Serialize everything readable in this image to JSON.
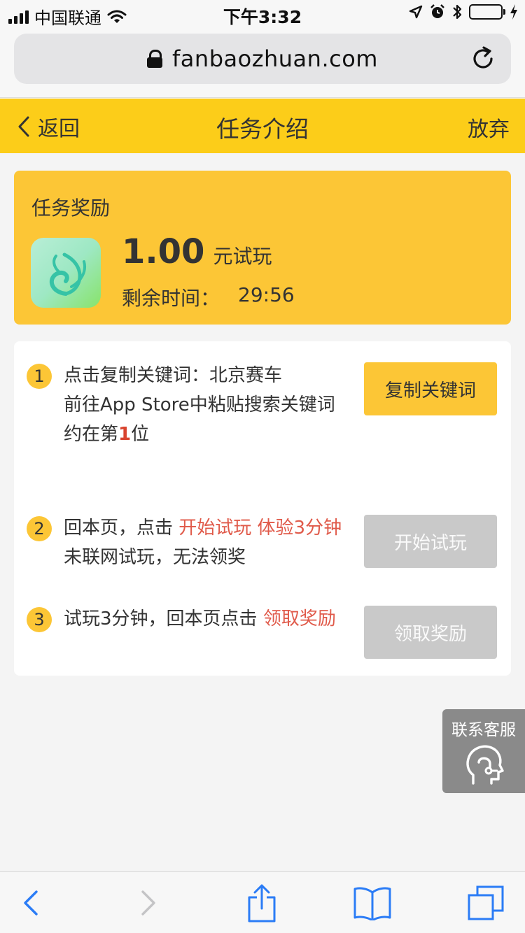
{
  "status_bar": {
    "carrier": "中国联通",
    "time": "下午3:32"
  },
  "browser": {
    "url": "fanbaozhuan.com"
  },
  "nav": {
    "back_label": "返回",
    "title": "任务介绍",
    "abandon_label": "放弃"
  },
  "reward": {
    "title": "任务奖励",
    "amount": "1.00",
    "amount_unit": "元试玩",
    "time_label": "剩余时间：",
    "time_value": "29:56"
  },
  "steps": [
    {
      "number": "1",
      "line1": "点击复制关键词：北京赛车",
      "line2": "前往App Store中粘贴搜索关键词",
      "line3_prefix": "约在第",
      "line3_rank": "1",
      "line3_suffix": "位",
      "button": "复制关键词"
    },
    {
      "number": "2",
      "line1_prefix": "回本页，点击 ",
      "line1_highlight": "开始试玩 体验3分钟",
      "line2": "未联网试玩，无法领奖",
      "button": "开始试玩"
    },
    {
      "number": "3",
      "line1_prefix": "试玩3分钟，回本页点击 ",
      "line1_highlight": "领取奖励",
      "button": "领取奖励"
    }
  ],
  "customer_service": {
    "label": "联系客服"
  },
  "colors": {
    "brand_yellow": "#fccd19",
    "card_yellow": "#fcc636",
    "highlight_red": "#e05a4a",
    "disabled_grey": "#c9c9c9",
    "ios_blue": "#2b7cf6"
  },
  "icons": {
    "status": [
      "signal-icon",
      "wifi-icon",
      "location-icon",
      "alarm-icon",
      "bluetooth-icon",
      "battery-icon",
      "charging-icon"
    ],
    "browser": [
      "lock-icon",
      "reload-icon"
    ],
    "toolbar": [
      "back-arrow-icon",
      "forward-arrow-icon",
      "share-icon",
      "bookmarks-icon",
      "tabs-icon"
    ]
  }
}
